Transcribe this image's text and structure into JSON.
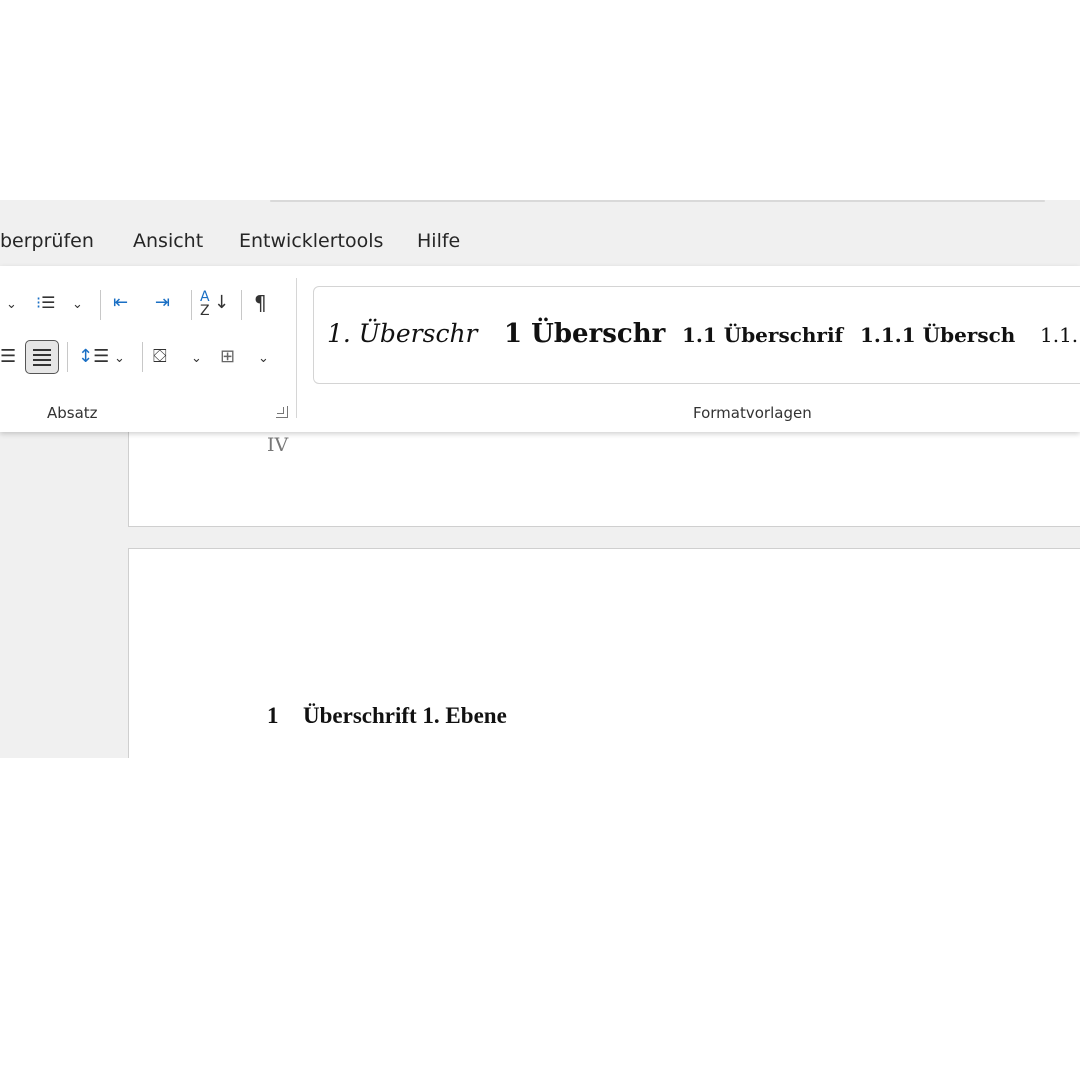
{
  "tabs": [
    "berprüfen",
    "Ansicht",
    "Entwicklertools",
    "Hilfe"
  ],
  "ribbon": {
    "paragraph_group_label": "Absatz",
    "styles_group_label": "Formatvorlagen",
    "icons": [
      "chevron-down-icon",
      "multilevel-list-icon",
      "decrease-indent-icon",
      "increase-indent-icon",
      "sort-icon",
      "show-formatting-marks-icon",
      "align-right-icon",
      "justify-icon",
      "line-spacing-icon",
      "shading-icon",
      "borders-icon"
    ],
    "show_marks_glyph": "¶",
    "styles": [
      {
        "label": "1.  Überschr"
      },
      {
        "label": "1  Überschr"
      },
      {
        "label": "1.1  Überschrif"
      },
      {
        "label": "1.1.1  Übersch"
      },
      {
        "label": "1.1."
      }
    ]
  },
  "document": {
    "page_number": "IV",
    "heading_number": "1",
    "heading_text": "Überschrift 1. Ebene"
  }
}
